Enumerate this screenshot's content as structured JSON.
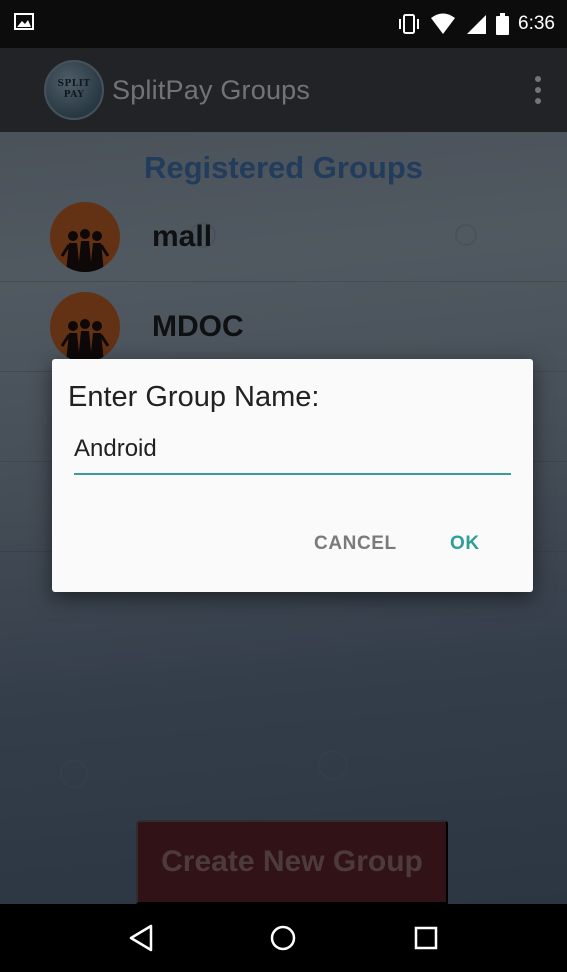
{
  "status_bar": {
    "time": "6:36"
  },
  "app_bar": {
    "title": "SplitPay Groups",
    "logo_text": "SPLIT PAY"
  },
  "main": {
    "section_title": "Registered Groups",
    "groups": [
      {
        "name": "mall"
      },
      {
        "name": "MDOC"
      }
    ],
    "create_button_label": "Create New Group"
  },
  "dialog": {
    "title": "Enter Group Name:",
    "input_value": "Android",
    "cancel_label": "CANCEL",
    "ok_label": "OK"
  },
  "colors": {
    "accent": "#2f9e96",
    "section_title": "#3e6da6",
    "create_button": "#5a2128"
  },
  "icons": {
    "status_left": "image-notification-icon",
    "status_right": [
      "vibrate-icon",
      "wifi-icon",
      "signal-icon",
      "battery-icon"
    ],
    "group_avatar": "group-people-icon",
    "nav": [
      "back-icon",
      "home-icon",
      "recents-icon"
    ]
  }
}
